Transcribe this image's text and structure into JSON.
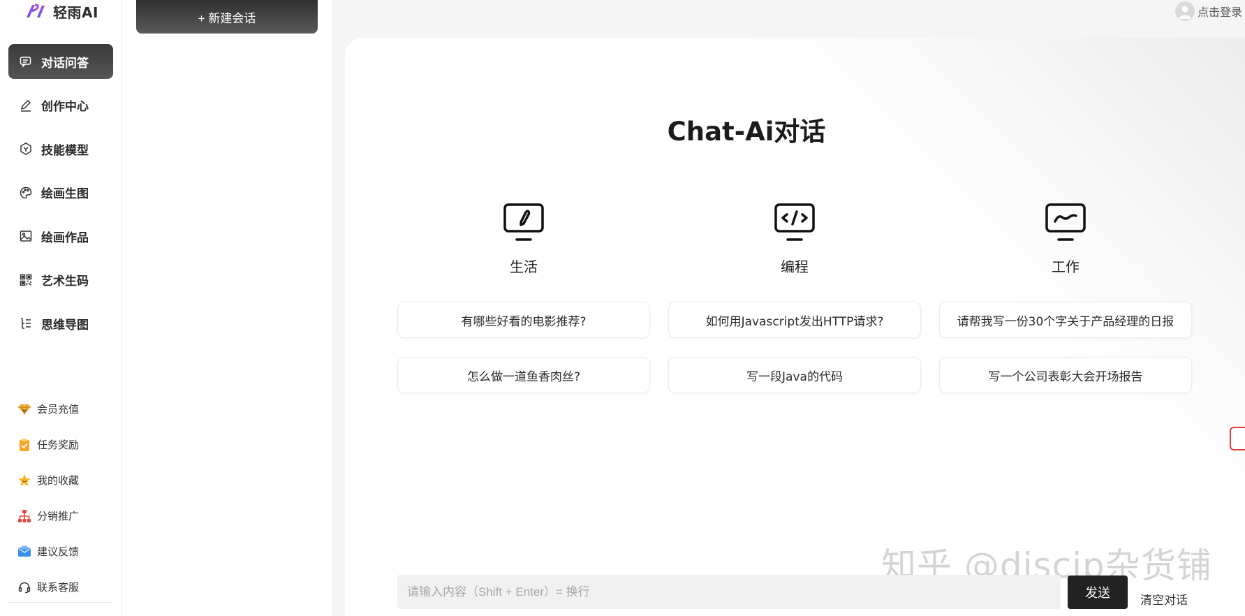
{
  "brand": {
    "name": "轻雨AI"
  },
  "nav": {
    "items": [
      {
        "label": "对话问答",
        "icon": "chat-icon",
        "active": true
      },
      {
        "label": "创作中心",
        "icon": "pen-icon",
        "active": false
      },
      {
        "label": "技能模型",
        "icon": "hexagon-icon",
        "active": false
      },
      {
        "label": "绘画生图",
        "icon": "palette-icon",
        "active": false
      },
      {
        "label": "绘画作品",
        "icon": "image-icon",
        "active": false
      },
      {
        "label": "艺术生码",
        "icon": "qrcode-icon",
        "active": false
      },
      {
        "label": "思维导图",
        "icon": "mindmap-icon",
        "active": false
      }
    ]
  },
  "sub_nav": {
    "items": [
      {
        "label": "会员充值",
        "icon": "diamond-icon"
      },
      {
        "label": "任务奖励",
        "icon": "clipboard-icon"
      },
      {
        "label": "我的收藏",
        "icon": "star-icon"
      },
      {
        "label": "分销推广",
        "icon": "org-chart-icon"
      },
      {
        "label": "建议反馈",
        "icon": "mail-icon"
      },
      {
        "label": "联系客服",
        "icon": "headset-icon"
      }
    ]
  },
  "conversations": {
    "new_chat_label": "+ 新建会话"
  },
  "header": {
    "login_label": "点击登录"
  },
  "main": {
    "title": "Chat-Ai对话",
    "categories": [
      {
        "label": "生活",
        "icon": "monitor-pen-icon",
        "prompts": [
          "有哪些好看的电影推荐?",
          "怎么做一道鱼香肉丝?"
        ]
      },
      {
        "label": "编程",
        "icon": "monitor-code-icon",
        "prompts": [
          "如何用Javascript发出HTTP请求?",
          "写一段Java的代码"
        ]
      },
      {
        "label": "工作",
        "icon": "monitor-wave-icon",
        "prompts": [
          "请帮我写一份30个字关于产品经理的日报",
          "写一个公司表彰大会开场报告"
        ]
      }
    ]
  },
  "composer": {
    "placeholder": "请输入内容（Shift + Enter）= 换行",
    "send_label": "发送",
    "clear_label": "清空对话"
  },
  "watermark": "知乎 @discip杂货铺"
}
